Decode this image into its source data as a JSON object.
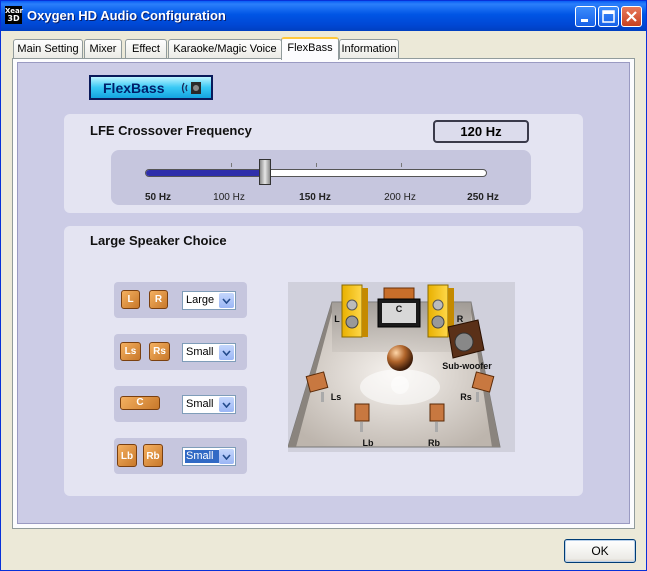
{
  "window": {
    "title": "Oxygen HD Audio Configuration",
    "icon_text_top": "Xear",
    "icon_text_bottom": "3D"
  },
  "tabs": [
    {
      "label": "Main Setting",
      "active": false
    },
    {
      "label": "Mixer",
      "active": false
    },
    {
      "label": "Effect",
      "active": false
    },
    {
      "label": "Karaoke/Magic Voice",
      "active": false
    },
    {
      "label": "FlexBass",
      "active": true
    },
    {
      "label": "Information",
      "active": false
    }
  ],
  "flexbass": {
    "label": "FlexBass",
    "icon": "speaker-sound-icon"
  },
  "crossover": {
    "title": "LFE Crossover Frequency",
    "value_display": "120 Hz",
    "slider_value_fraction": 0.35,
    "ticks": [
      {
        "label": "50 Hz",
        "bold": true
      },
      {
        "label": "100 Hz",
        "bold": false
      },
      {
        "label": "150 Hz",
        "bold": true
      },
      {
        "label": "200 Hz",
        "bold": false
      },
      {
        "label": "250 Hz",
        "bold": true
      }
    ]
  },
  "speakers": {
    "title": "Large Speaker Choice",
    "rows": [
      {
        "icons": [
          "L",
          "R"
        ],
        "selected": "Large"
      },
      {
        "icons": [
          "Ls",
          "Rs"
        ],
        "selected": "Small"
      },
      {
        "icons": [
          "C"
        ],
        "selected": "Small"
      },
      {
        "icons": [
          "Lb",
          "Rb"
        ],
        "selected": "Small"
      }
    ],
    "diagram_labels": {
      "l": "L",
      "c": "C",
      "r": "R",
      "sub": "Sub-woofer",
      "ls": "Ls",
      "rs": "Rs",
      "lb": "Lb",
      "rb": "Rb"
    }
  },
  "ok_button": "OK",
  "colors": {
    "title_bar": "#0055e5",
    "flexbass_button": "#39c9f5",
    "slider_fill": "#2e2eaa",
    "speaker_orange": "#e89848",
    "focus_select": "#316ac5"
  }
}
